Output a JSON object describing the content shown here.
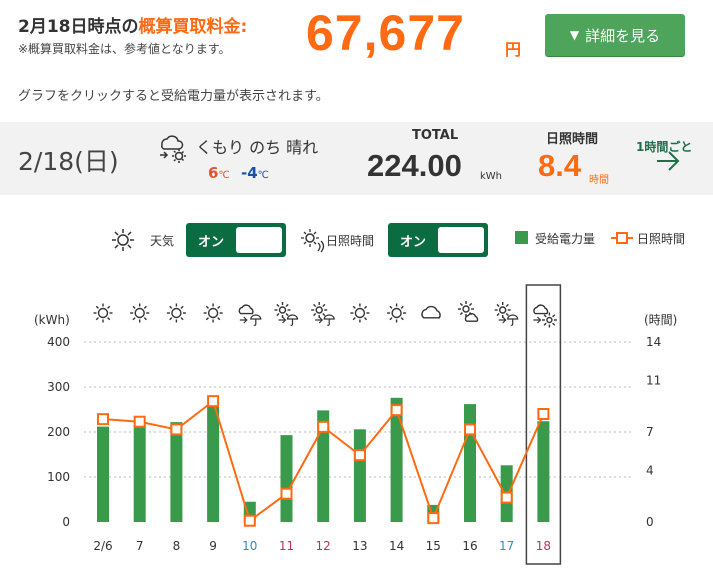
{
  "header": {
    "title_prefix": "2月18日時点の",
    "title_highlight": "概算買取料金:",
    "amount": "67,677",
    "amount_unit": "円",
    "note": "※概算買取料金は、参考値となります。",
    "detail_button": "詳細を見る",
    "detail_button_icon": "▼"
  },
  "hint": "グラフをクリックすると受給電力量が表示されます。",
  "day": {
    "date": "2/18(日)",
    "weather_text": "くもり のち 晴れ",
    "weather_icon": "cloud-then-sun-icon",
    "temp_high": "6",
    "temp_low": "-4",
    "temp_unit": "℃",
    "total_label": "TOTAL",
    "total_value": "224.00",
    "total_unit": "kWh",
    "sunshine_label": "日照時間",
    "sunshine_value": "8.4",
    "sunshine_unit": "時間",
    "hourly_link": "1時間ごと",
    "hourly_icon": "→"
  },
  "controls": {
    "weather_toggle_label": "天気",
    "weather_toggle_state": "オン",
    "sunshine_toggle_label": "日照時間",
    "sunshine_toggle_state": "オン",
    "legend_power": "受給電力量",
    "legend_sunshine": "日照時間"
  },
  "colors": {
    "accent_orange": "#ff6a13",
    "bar_green": "#3a9a4b",
    "toggle_green": "#0b6b41",
    "button_green": "#4da45a",
    "weekend_blue": "#2a8fc0",
    "holiday_red": "#c0305a"
  },
  "chart_data": {
    "type": "bar",
    "categories": [
      "2/6",
      "7",
      "8",
      "9",
      "10",
      "11",
      "12",
      "13",
      "14",
      "15",
      "16",
      "17",
      "18"
    ],
    "category_colors": [
      "#333",
      "#333",
      "#333",
      "#333",
      "#2a8fc0",
      "#c0305a",
      "#c0305a",
      "#333",
      "#333",
      "#333",
      "#333",
      "#2a8fc0",
      "#c0305a"
    ],
    "weather_icons": [
      "sun-icon",
      "sun-icon",
      "sun-icon",
      "sun-icon",
      "cloud-rain-icon",
      "sun-rain-icon",
      "sun-rain-icon",
      "sun-icon",
      "sun-icon",
      "cloud-icon",
      "sun-cloud-icon",
      "sun-rain-icon",
      "cloud-then-sun-icon"
    ],
    "series": [
      {
        "name": "受給電力量",
        "type": "bar",
        "axis": "left",
        "values": [
          212,
          216,
          222,
          258,
          45,
          193,
          248,
          206,
          276,
          38,
          262,
          126,
          224
        ]
      },
      {
        "name": "日照時間",
        "type": "line",
        "axis": "right",
        "values": [
          8.0,
          7.8,
          7.2,
          9.4,
          0.1,
          2.2,
          7.4,
          5.2,
          8.7,
          0.3,
          7.2,
          1.9,
          8.4
        ]
      }
    ],
    "left_axis": {
      "label": "(kWh)",
      "ticks": [
        0,
        100,
        200,
        300,
        400
      ],
      "ylim": [
        0,
        400
      ]
    },
    "right_axis": {
      "label": "(時間)",
      "ticks": [
        0,
        4,
        7,
        11,
        14
      ],
      "ylim": [
        0,
        14
      ]
    },
    "selected_index": 12,
    "grid": true
  }
}
